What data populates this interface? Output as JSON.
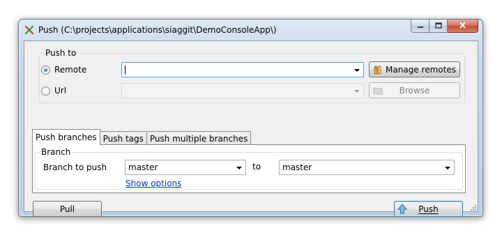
{
  "window": {
    "title": "Push (C:\\projects\\applications\\siaggit\\DemoConsoleApp\\)",
    "app_icon": "git-extensions-icon",
    "caption_icons": [
      "minimize-icon",
      "maximize-icon",
      "close-icon"
    ]
  },
  "push_to": {
    "group_label": "Push to",
    "remote_label": "Remote",
    "remote_selected": true,
    "remote_value": "",
    "manage_remotes_label": "Manage remotes",
    "url_label": "Url",
    "url_value": "",
    "browse_label": "Browse"
  },
  "tabs": [
    "Push branches",
    "Push tags",
    "Push multiple branches"
  ],
  "active_tab": "Push branches",
  "branch": {
    "group_label": "Branch",
    "branch_to_push_label": "Branch to push",
    "local_branch": "master",
    "to_label": "to",
    "remote_branch": "master",
    "show_options_link": "Show options"
  },
  "buttons": {
    "pull_label": "Pull",
    "push_label": "Push"
  },
  "colors": {
    "link": "#0033cc",
    "close_button": "#c24a32",
    "default_button_border": "#3c7fb1"
  }
}
